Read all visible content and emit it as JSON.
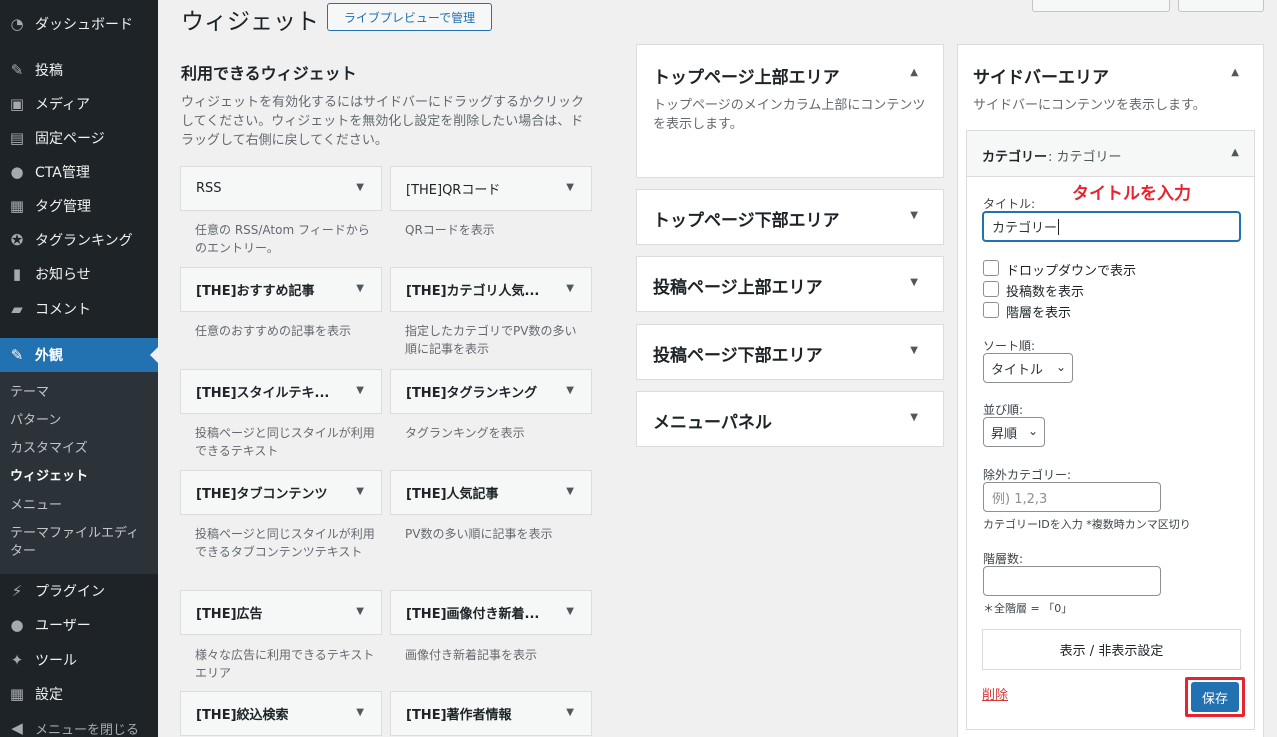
{
  "menu": {
    "items": [
      {
        "label": "ダッシュボード",
        "icon": "dashboard-icon",
        "glyph": "◔"
      },
      {
        "label": "投稿",
        "icon": "pin-icon",
        "glyph": "✎"
      },
      {
        "label": "メディア",
        "icon": "media-icon",
        "glyph": "▣"
      },
      {
        "label": "固定ページ",
        "icon": "page-icon",
        "glyph": "▤"
      },
      {
        "label": "CTA管理",
        "icon": "lightbulb-icon",
        "glyph": "●"
      },
      {
        "label": "タグ管理",
        "icon": "tag-layout-icon",
        "glyph": "▦"
      },
      {
        "label": "タグランキング",
        "icon": "award-icon",
        "glyph": "✪"
      },
      {
        "label": "お知らせ",
        "icon": "book-icon",
        "glyph": "▮"
      },
      {
        "label": "コメント",
        "icon": "comment-icon",
        "glyph": "▰"
      },
      {
        "label": "外観",
        "icon": "appearance-icon",
        "glyph": "✎"
      }
    ],
    "submenu": [
      "テーマ",
      "パターン",
      "カスタマイズ",
      "ウィジェット",
      "メニュー",
      "テーマファイルエディター"
    ],
    "bottom_items": [
      {
        "label": "プラグイン",
        "icon": "plugin-icon",
        "glyph": "⚡"
      },
      {
        "label": "ユーザー",
        "icon": "user-icon",
        "glyph": "●"
      },
      {
        "label": "ツール",
        "icon": "wrench-icon",
        "glyph": "✦"
      },
      {
        "label": "設定",
        "icon": "settings-icon",
        "glyph": "▦"
      }
    ],
    "collapse": "メニューを閉じる"
  },
  "header": {
    "title": "ウィジェット",
    "live_preview": "ライブプレビューで管理"
  },
  "available": {
    "title": "利用できるウィジェット",
    "description": "ウィジェットを有効化するにはサイドバーにドラッグするかクリックしてください。ウィジェットを無効化し設定を削除したい場合は、ドラッグして右側に戻してください。",
    "widgets": [
      {
        "name": "RSS",
        "desc": "任意の RSS/Atom フィードからのエントリー。"
      },
      {
        "name": "[THE]QRコード",
        "desc": "QRコードを表示"
      },
      {
        "name": "[THE]おすすめ記事",
        "desc": "任意のおすすめの記事を表示"
      },
      {
        "name": "[THE]カテゴリ人気...",
        "desc": "指定したカテゴリでPV数の多い順に記事を表示"
      },
      {
        "name": "[THE]スタイルテキ...",
        "desc": "投稿ページと同じスタイルが利用できるテキスト"
      },
      {
        "name": "[THE]タグランキング",
        "desc": "タグランキングを表示"
      },
      {
        "name": "[THE]タブコンテンツ",
        "desc": "投稿ページと同じスタイルが利用できるタブコンテンツテキスト"
      },
      {
        "name": "[THE]人気記事",
        "desc": "PV数の多い順に記事を表示"
      },
      {
        "name": "[THE]広告",
        "desc": "様々な広告に利用できるテキストエリア"
      },
      {
        "name": "[THE]画像付き新着...",
        "desc": "画像付き新着記事を表示"
      },
      {
        "name": "[THE]絞込検索",
        "desc": ""
      },
      {
        "name": "[THE]著作者情報",
        "desc": ""
      }
    ]
  },
  "areas": [
    {
      "title": "トップページ上部エリア",
      "desc": "トップページのメインカラム上部にコンテンツを表示します。"
    },
    {
      "title": "トップページ下部エリア",
      "desc": ""
    },
    {
      "title": "投稿ページ上部エリア",
      "desc": ""
    },
    {
      "title": "投稿ページ下部エリア",
      "desc": ""
    },
    {
      "title": "メニューパネル",
      "desc": ""
    }
  ],
  "sidebar_area": {
    "title": "サイドバーエリア",
    "desc": "サイドバーにコンテンツを表示します。",
    "widget": {
      "header_name": "カテゴリー",
      "header_sub": ": カテゴリー",
      "annotation": "タイトルを入力",
      "title_label": "タイトル:",
      "title_value": "カテゴリー",
      "checkboxes": [
        "ドロップダウンで表示",
        "投稿数を表示",
        "階層を表示"
      ],
      "sort_label": "ソート順:",
      "sort_value": "タイトル",
      "order_label": "並び順:",
      "order_value": "昇順",
      "exclude_label": "除外カテゴリー:",
      "exclude_placeholder": "例) 1,2,3",
      "exclude_help": "カテゴリーIDを入力 *複数時カンマ区切り",
      "depth_label": "階層数:",
      "depth_help": "＊全階層 = 「0」",
      "visibility": "表示 / 非表示設定",
      "delete": "削除",
      "save": "保存"
    }
  }
}
